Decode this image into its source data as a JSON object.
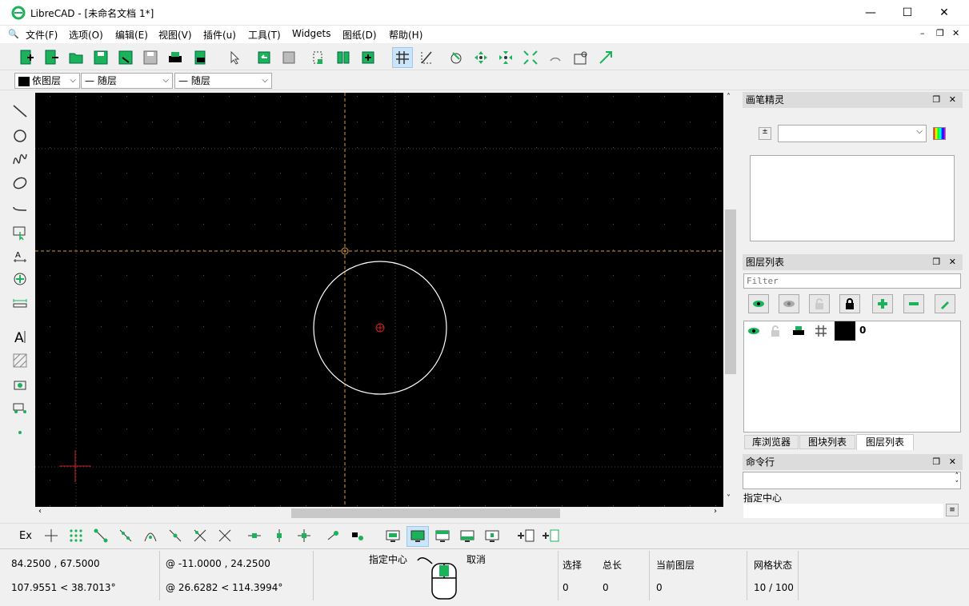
{
  "window": {
    "title": "LibreCAD - [未命名文档 1*]",
    "minimize": "—",
    "maximize": "☐",
    "close": "✕"
  },
  "menu": [
    "文件(F)",
    "选项(O)",
    "编辑(E)",
    "视图(V)",
    "插件(u)",
    "工具(T)",
    "Widgets",
    "图纸(D)",
    "帮助(H)"
  ],
  "toolbar2": {
    "color": "依图层",
    "linetype": "— 随层",
    "linewidth": "— 随层"
  },
  "panels": {
    "pen": {
      "title": "画笔精灵"
    },
    "layers": {
      "title": "图层列表",
      "filter_placeholder": "Filter",
      "rows": [
        {
          "name": "0",
          "color": "#000000"
        }
      ]
    },
    "tabs": [
      "库浏览器",
      "图块列表",
      "图层列表"
    ],
    "cmd": {
      "title": "命令行",
      "prompt": "指定中心"
    }
  },
  "snapbar": {
    "ex_label": "Ex"
  },
  "status": {
    "abs_coord": "84.2500 , 67.5000",
    "abs_polar": "107.9551 < 38.7013°",
    "rel_coord": "@  -11.0000 , 24.2500",
    "rel_polar": "@  26.6282 < 114.3994°",
    "mouse_left": "指定中心",
    "mouse_right": "取消",
    "selected_label": "选择",
    "selected_value": "0",
    "length_label": "总长",
    "length_value": "0",
    "layer_label": "当前图层",
    "layer_value": "0",
    "grid_label": "网格状态",
    "grid_value": "10 / 100"
  },
  "colors": {
    "accent_green": "#1bb35a",
    "crosshair": "#d39a2f",
    "circle": "#ffffff",
    "origin": "#d02020"
  }
}
